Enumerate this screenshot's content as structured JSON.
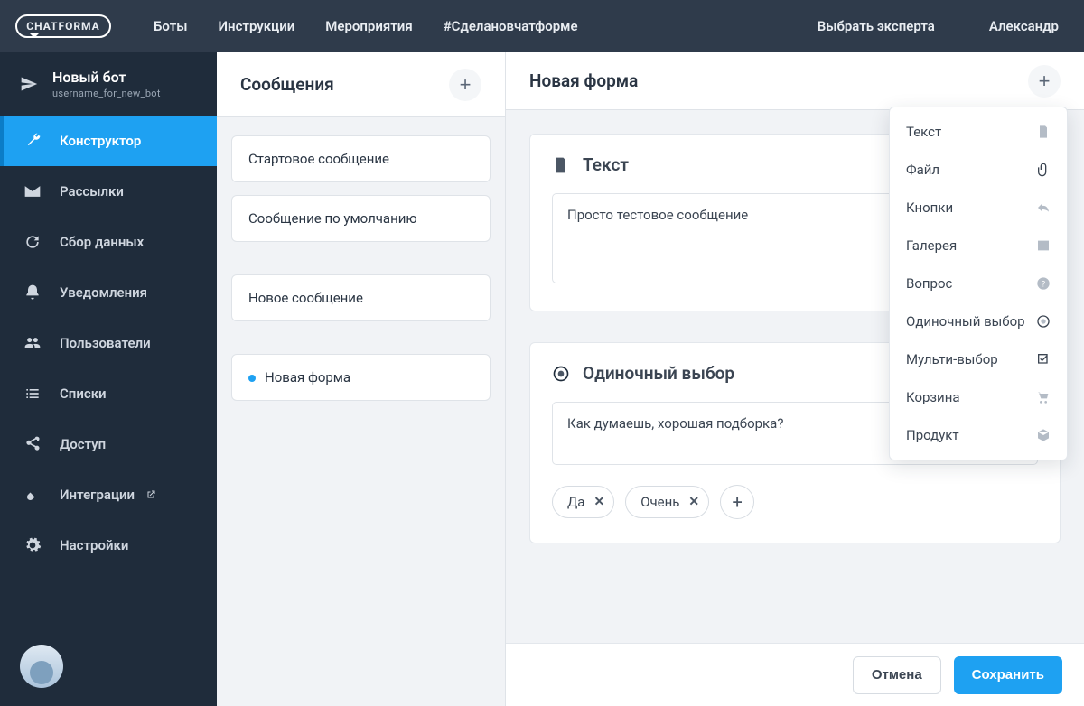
{
  "topbar": {
    "logo": "CHATFORMA",
    "nav": [
      "Боты",
      "Инструкции",
      "Мероприятия",
      "#Сделановчатформе"
    ],
    "expert": "Выбрать эксперта",
    "user": "Александр"
  },
  "bot": {
    "title": "Новый бот",
    "subtitle": "username_for_new_bot"
  },
  "sidebar": {
    "items": [
      {
        "label": "Конструктор",
        "icon": "wrench",
        "active": true
      },
      {
        "label": "Рассылки",
        "icon": "mail"
      },
      {
        "label": "Сбор данных",
        "icon": "refresh"
      },
      {
        "label": "Уведомления",
        "icon": "bell"
      },
      {
        "label": "Пользователи",
        "icon": "users"
      },
      {
        "label": "Списки",
        "icon": "list"
      },
      {
        "label": "Доступ",
        "icon": "share"
      },
      {
        "label": "Интеграции",
        "icon": "plug",
        "external": true
      },
      {
        "label": "Настройки",
        "icon": "gear"
      }
    ]
  },
  "messages": {
    "title": "Сообщения",
    "items": [
      {
        "label": "Стартовое сообщение"
      },
      {
        "label": "Сообщение по умолчанию"
      },
      {
        "label": "Новое сообщение",
        "gap": true
      },
      {
        "label": "Новая форма",
        "active": true,
        "gap": true
      }
    ]
  },
  "form": {
    "title": "Новая форма",
    "blocks": {
      "text": {
        "title": "Текст",
        "value": "Просто тестовое сообщение"
      },
      "single": {
        "title": "Одиночный выбор",
        "value": "Как думаешь, хорошая подборка?",
        "options": [
          "Да",
          "Очень"
        ]
      }
    },
    "footer": {
      "cancel": "Отмена",
      "save": "Сохранить"
    }
  },
  "dropdown": [
    {
      "label": "Текст",
      "icon": "file"
    },
    {
      "label": "Файл",
      "icon": "clip"
    },
    {
      "label": "Кнопки",
      "icon": "reply"
    },
    {
      "label": "Галерея",
      "icon": "image"
    },
    {
      "label": "Вопрос",
      "icon": "question"
    },
    {
      "label": "Одиночный выбор",
      "icon": "radio"
    },
    {
      "label": "Мульти-выбор",
      "icon": "check"
    },
    {
      "label": "Корзина",
      "icon": "cart"
    },
    {
      "label": "Продукт",
      "icon": "box"
    }
  ]
}
